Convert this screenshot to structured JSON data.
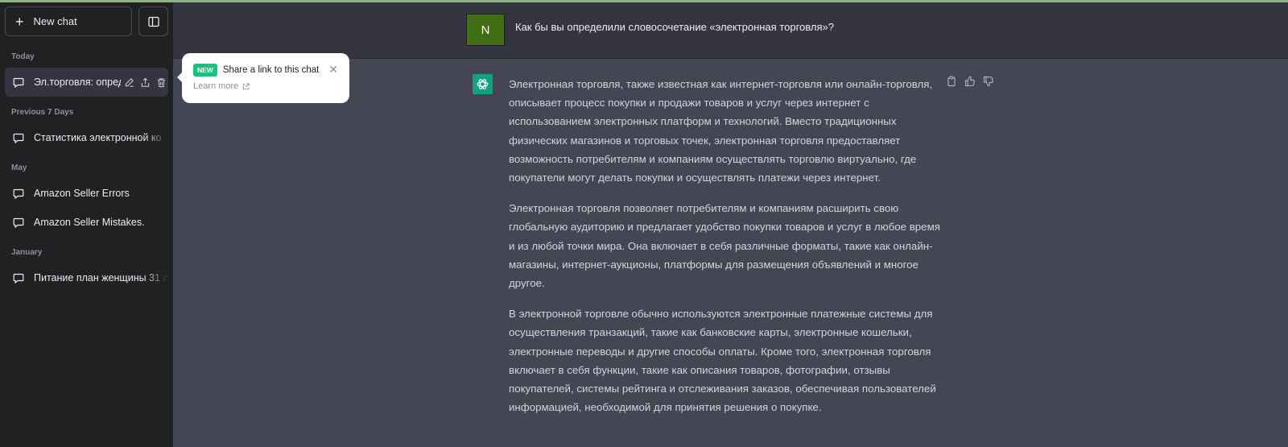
{
  "sidebar": {
    "new_chat_label": "New chat",
    "sections": {
      "today": "Today",
      "previous7": "Previous 7 Days",
      "may": "May",
      "january": "January"
    },
    "items": [
      {
        "label": "Эл.торговля: опред"
      },
      {
        "label": "Статистика электронной ко"
      },
      {
        "label": "Amazon Seller Errors"
      },
      {
        "label": "Amazon Seller Mistakes."
      },
      {
        "label": "Питание план женщины 31 л"
      }
    ]
  },
  "popup": {
    "badge": "NEW",
    "title": "Share a link to this chat",
    "link": "Learn more",
    "close_symbol": "✕"
  },
  "user_message": {
    "avatar_letter": "N",
    "text": "Как бы вы определили словосочетание  «электронная торговля»?"
  },
  "assistant_message": {
    "paragraphs": [
      "Электронная торговля, также известная как интернет-торговля или онлайн-торговля, описывает процесс покупки и продажи товаров и услуг через интернет с использованием электронных платформ и технологий. Вместо традиционных физических магазинов и торговых точек, электронная торговля предоставляет возможность потребителям и компаниям осуществлять торговлю виртуально, где покупатели могут делать покупки и осуществлять платежи через интернет.",
      "Электронная торговля позволяет потребителям и компаниям расширить свою глобальную аудиторию и предлагает удобство покупки товаров и услуг в любое время и из любой точки мира. Она включает в себя различные форматы, такие как онлайн-магазины, интернет-аукционы, платформы для размещения объявлений и многое другое.",
      "В электронной торговле обычно используются электронные платежные системы для осуществления транзакций, такие как банковские карты, электронные кошельки, электронные переводы и другие способы оплаты. Кроме того, электронная торговля включает в себя функции, такие как описания товаров, фотографии, отзывы покупателей, системы рейтинга и отслеживания заказов, обеспечивая пользователей информацией, необходимой для принятия решения о покупке."
    ]
  },
  "colors": {
    "sidebar_bg": "#202123",
    "main_bg": "#343541",
    "assistant_bg": "#444654",
    "accent_green": "#19c37d",
    "user_avatar_bg": "#3f6e15",
    "gpt_logo_bg": "#10a37f"
  },
  "icons": [
    "plus-icon",
    "sidebar-toggle-icon",
    "chat-bubble-icon",
    "edit-icon",
    "share-icon",
    "trash-icon",
    "close-icon",
    "external-link-icon",
    "openai-logo-icon",
    "copy-icon",
    "thumbs-up-icon",
    "thumbs-down-icon"
  ]
}
